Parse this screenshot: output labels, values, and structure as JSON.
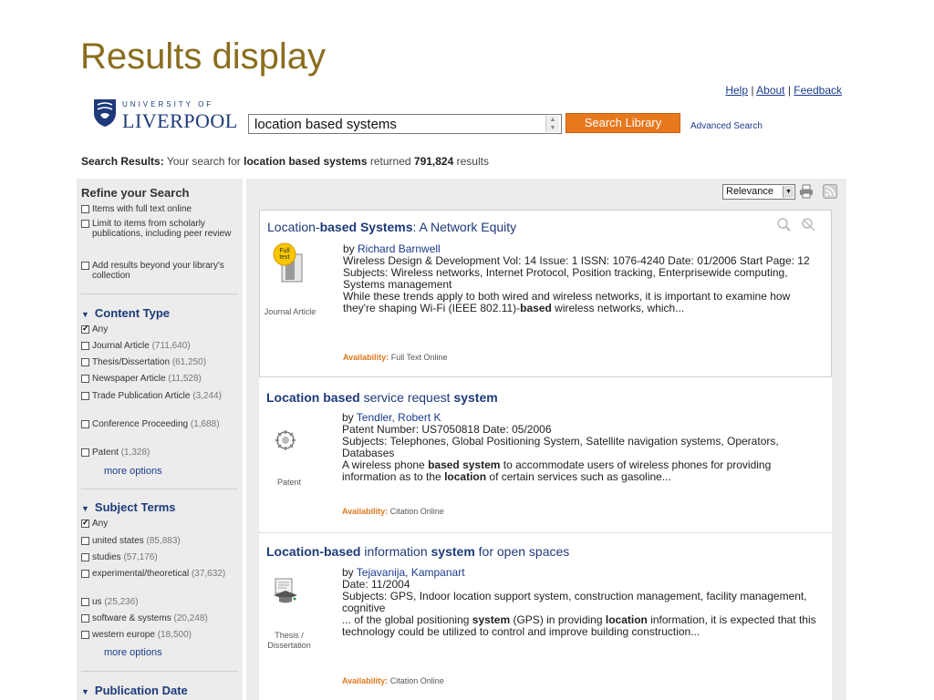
{
  "slide_title": "Results display",
  "top_links": {
    "help": "Help",
    "about": "About",
    "feedback": "Feedback"
  },
  "logo": {
    "small": "UNIVERSITY OF",
    "big": "LIVERPOOL"
  },
  "search": {
    "value": "location based systems",
    "button": "Search Library",
    "advanced": "Advanced Search"
  },
  "summary": {
    "label": "Search Results:",
    "pre": "Your search for",
    "query": "location based systems",
    "mid": "returned",
    "count": "791,824",
    "post": "results"
  },
  "sidebar": {
    "title": "Refine your Search",
    "options": [
      "Items with full text online",
      "Limit to items from scholarly publications, including peer review",
      "Add results beyond your library's collection"
    ],
    "content_type": {
      "title": "Content Type",
      "items": [
        {
          "label": "Any",
          "count": "",
          "checked": true
        },
        {
          "label": "Journal Article",
          "count": "(711,640)",
          "checked": false
        },
        {
          "label": "Thesis/Dissertation",
          "count": "(61,250)",
          "checked": false
        },
        {
          "label": "Newspaper Article",
          "count": "(11,528)",
          "checked": false
        },
        {
          "label": "Trade Publication Article",
          "count": "(3,244)",
          "checked": false
        },
        {
          "label": "Conference Proceeding",
          "count": "(1,688)",
          "checked": false
        },
        {
          "label": "Patent",
          "count": "(1,328)",
          "checked": false
        }
      ],
      "more": "more options"
    },
    "subject_terms": {
      "title": "Subject Terms",
      "items": [
        {
          "label": "Any",
          "count": "",
          "checked": true
        },
        {
          "label": "united states",
          "count": "(85,883)",
          "checked": false
        },
        {
          "label": "studies",
          "count": "(57,176)",
          "checked": false
        },
        {
          "label": "experimental/theoretical",
          "count": "(37,632)",
          "checked": false
        },
        {
          "label": "us",
          "count": "(25,236)",
          "checked": false
        },
        {
          "label": "software & systems",
          "count": "(20,248)",
          "checked": false
        },
        {
          "label": "western europe",
          "count": "(18,500)",
          "checked": false
        }
      ],
      "more": "more options"
    },
    "publication_date": {
      "title": "Publication Date"
    }
  },
  "sort": {
    "value": "Relevance"
  },
  "results": [
    {
      "title_a": "Location-",
      "title_b": "based Systems",
      "title_c": ": A Network Equity",
      "icon": "full-text-journal-icon",
      "badge": "Full text",
      "type": "Journal Article",
      "by": "by ",
      "authors": "Richard Barnwell",
      "line1": "Wireless Design & Development Vol: 14 Issue: 1 ISSN: 1076-4240 Date: 01/2006 Start Page: 12",
      "line2": "Subjects: Wireless networks, Internet Protocol, Position tracking, Enterprisewide computing, Systems management",
      "snippet_a": "While these trends apply to both wired and wireless networks, it is important to examine how they're shaping Wi-Fi (IEEE 802.11)-",
      "snippet_b": "based",
      "snippet_c": " wireless networks, which...",
      "avail_label": "Availability:",
      "avail_value": "Full Text Online"
    },
    {
      "title_a": "Location ",
      "title_b": "based",
      "title_c": " service request ",
      "title_d": "system",
      "icon": "patent-icon",
      "type": "Patent",
      "by": "by ",
      "authors": "Tendler, Robert K",
      "line1": "Patent Number: US7050818 Date: 05/2006",
      "line2": "Subjects: Telephones, Global Positioning System, Satellite navigation systems, Operators, Databases",
      "snippet_a": "A wireless phone ",
      "snippet_b": "based system",
      "snippet_c": " to accommodate users of wireless phones for providing information as to the ",
      "snippet_d": "location",
      "snippet_e": " of certain services such as gasoline...",
      "avail_label": "Availability:",
      "avail_value": "Citation Online"
    },
    {
      "title_a": "Location-",
      "title_b": "based",
      "title_c": " information ",
      "title_d": "system",
      "title_e": " for open spaces",
      "icon": "thesis-icon",
      "type": "Thesis / Dissertation",
      "by": "by ",
      "authors": "Tejavanija, Kampanart",
      "line1": "Date: 11/2004",
      "line2": "Subjects: GPS, Indoor location support system, construction management, facility management, cognitive",
      "snippet_a": "... of the global positioning ",
      "snippet_b": "system",
      "snippet_c": " (GPS) in providing ",
      "snippet_d": "location",
      "snippet_e": " information, it is expected that this technology could be utilized to control and improve building construction...",
      "avail_label": "Availability:",
      "avail_value": "Citation Online"
    }
  ]
}
